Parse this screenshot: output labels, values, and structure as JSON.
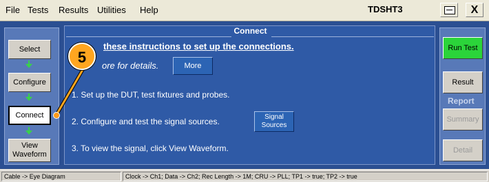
{
  "menu": {
    "items": [
      "File",
      "Tests",
      "Results",
      "Utilities",
      "Help"
    ],
    "app_title": "TDSHT3",
    "close_label": "X"
  },
  "panel": {
    "title": "Connect"
  },
  "workflow": {
    "steps": [
      {
        "label": "Select"
      },
      {
        "label": "Configure"
      },
      {
        "label": "Connect"
      },
      {
        "label": "View Waveform"
      }
    ]
  },
  "side": {
    "run_test": "Run Test",
    "result": "Result",
    "report_label": "Report",
    "summary": "Summary",
    "detail": "Detail"
  },
  "instructions": {
    "heading": "these instructions to set up the connections.",
    "more_text": "ore for details.",
    "more_button": "More",
    "line1": "1. Set up the DUT, test fixtures and probes.",
    "line2": "2. Configure and test the signal sources.",
    "signal_sources_button": "Signal Sources",
    "line3": "3. To view the signal, click View Waveform."
  },
  "callout": {
    "number": "5"
  },
  "status": {
    "left": "Cable -> Eye Diagram",
    "right": "Clock -> Ch1; Data -> Ch2; Rec Length -> 1M; CRU -> PLL; TP1 -> true; TP2 -> true"
  },
  "colors": {
    "frame": "#2b4f92",
    "panel": "#2f5aa6",
    "run_test": "#2bd43a",
    "callout": "#ffa620",
    "arrow": "#39d14a"
  }
}
